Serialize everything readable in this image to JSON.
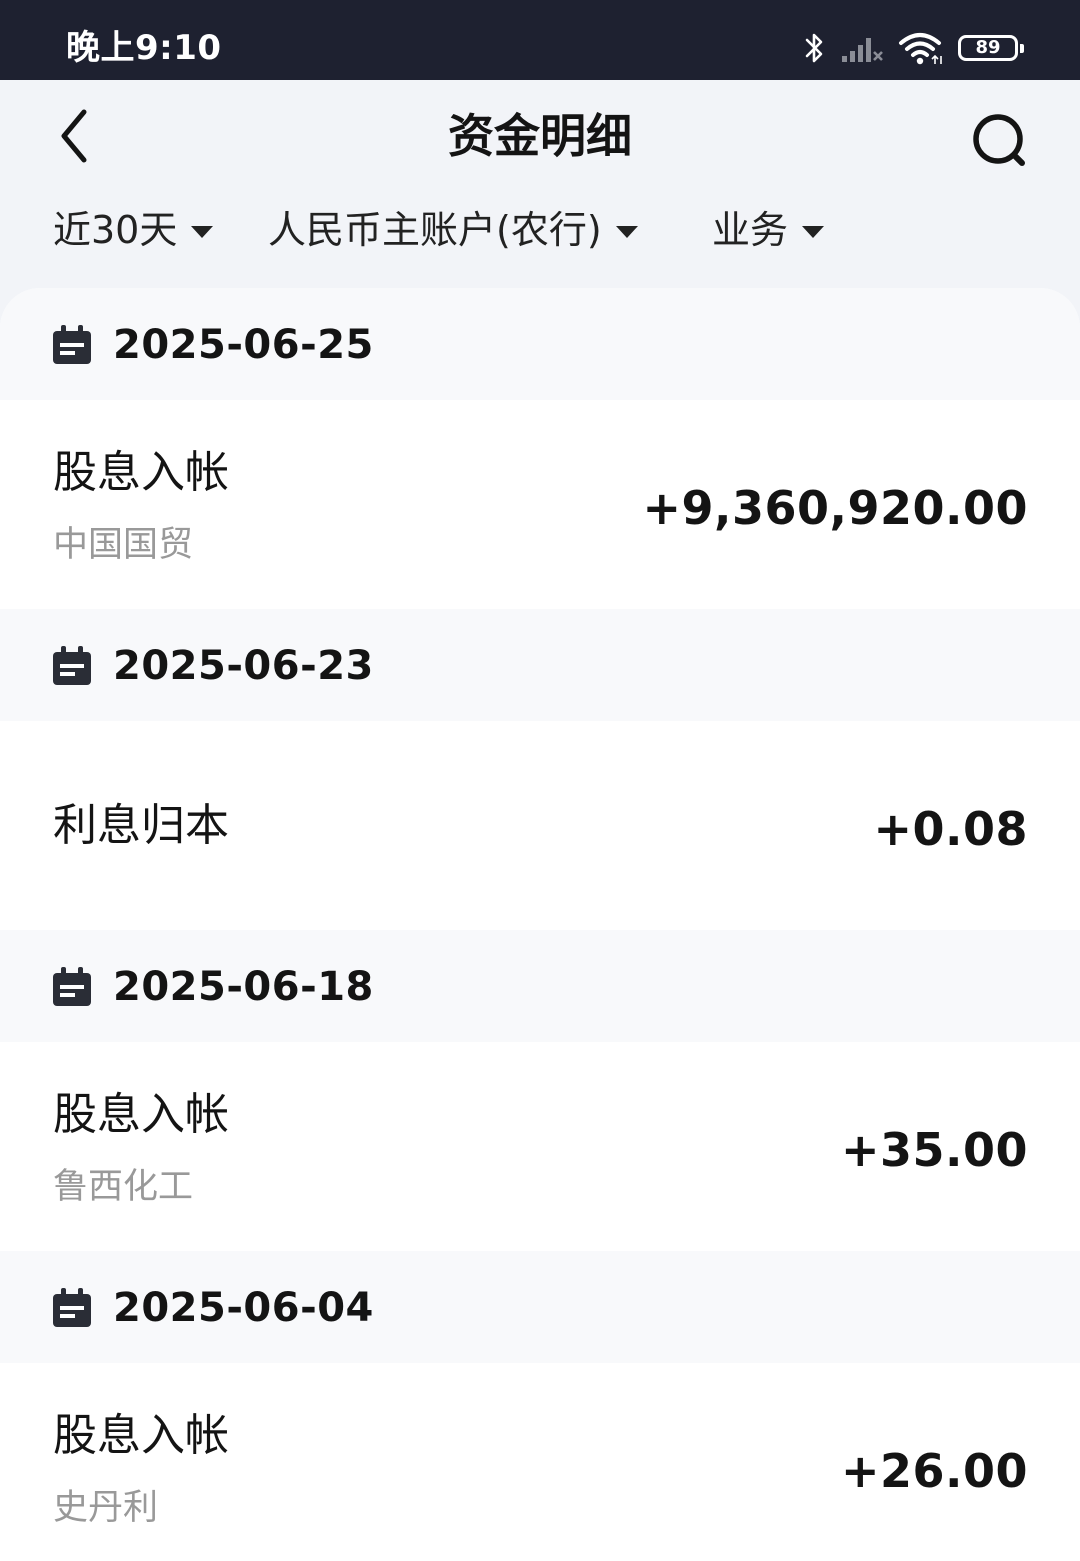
{
  "status_bar": {
    "time": "晚上9:10",
    "battery": "89",
    "icons": [
      "bluetooth-icon",
      "signal-icon",
      "wifi-icon",
      "battery-icon"
    ]
  },
  "header": {
    "title": "资金明细",
    "back_icon": "chevron-left-icon",
    "search_icon": "search-icon"
  },
  "filters": {
    "period": "近30天",
    "account": "人民币主账户(农行)",
    "business": "业务"
  },
  "groups": [
    {
      "date": "2025-06-25",
      "items": [
        {
          "title": "股息入帐",
          "subtitle": "中国国贸",
          "amount": "+9,360,920.00"
        }
      ]
    },
    {
      "date": "2025-06-23",
      "items": [
        {
          "title": "利息归本",
          "subtitle": "",
          "amount": "+0.08"
        }
      ]
    },
    {
      "date": "2025-06-18",
      "items": [
        {
          "title": "股息入帐",
          "subtitle": "鲁西化工",
          "amount": "+35.00"
        }
      ]
    },
    {
      "date": "2025-06-04",
      "items": [
        {
          "title": "股息入帐",
          "subtitle": "史丹利",
          "amount": "+26.00"
        }
      ]
    }
  ],
  "colors": {
    "status_bar_bg": "#1e2130",
    "page_bg": "#f2f4f8",
    "date_row_bg": "#f8f9fb",
    "text_primary": "#141414",
    "text_secondary": "#999999"
  }
}
